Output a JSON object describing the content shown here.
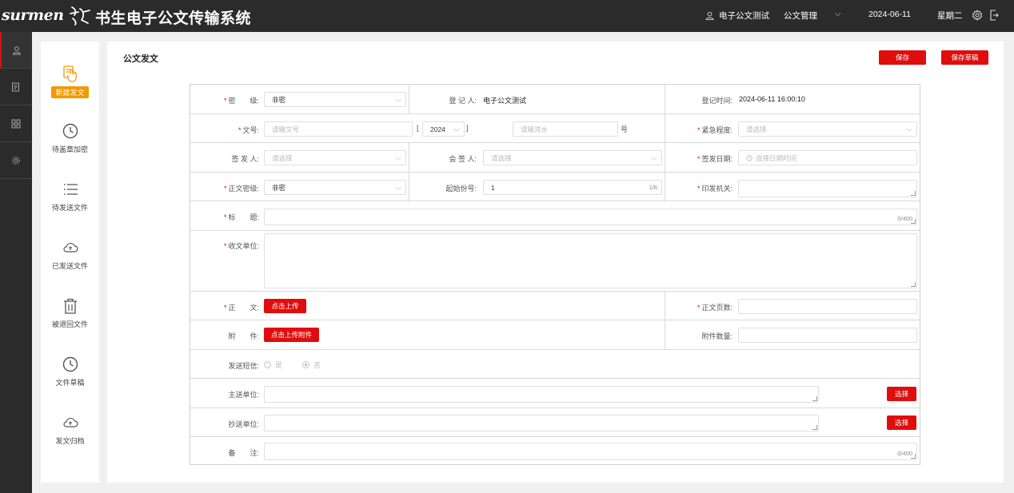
{
  "header": {
    "logo_text": "surmen",
    "app_title": "书生电子公文传输系统",
    "user_name": "电子公文测试",
    "menu_label": "公文管理",
    "date": "2024-06-11",
    "weekday": "星期二",
    "icons": {
      "user": "user-icon",
      "chevron": "chevron-down-icon",
      "settings": "gear-icon",
      "logout": "logout-icon"
    }
  },
  "rail": {
    "items": [
      {
        "icon": "user-icon",
        "active": true
      },
      {
        "icon": "document-edit-icon",
        "active": false
      },
      {
        "icon": "grid-icon",
        "active": false
      },
      {
        "icon": "gear-icon",
        "active": false
      }
    ]
  },
  "sidebar": {
    "items": [
      {
        "label": "新建发文",
        "icon": "hand-document-icon",
        "active": true
      },
      {
        "label": "待盖章加密",
        "icon": "clock-icon",
        "active": false
      },
      {
        "label": "待发送文件",
        "icon": "list-icon",
        "active": false
      },
      {
        "label": "已发送文件",
        "icon": "cloud-upload-icon",
        "active": false
      },
      {
        "label": "被退回文件",
        "icon": "trash-icon",
        "active": false
      },
      {
        "label": "文件草稿",
        "icon": "clock-icon",
        "active": false
      },
      {
        "label": "发文归档",
        "icon": "cloud-upload-icon",
        "active": false
      }
    ]
  },
  "main": {
    "title": "公文发文",
    "save_label": "保存",
    "save_draft_label": "保存草稿"
  },
  "form": {
    "secret_level": {
      "label": "密　　级:",
      "value": "非密",
      "required": true
    },
    "registrar": {
      "label": "登 记 人:",
      "value": "电子公文测试"
    },
    "register_time": {
      "label": "登记时间:",
      "value": "2024-06-11 16:00:10"
    },
    "doc_number": {
      "label": "文号:",
      "placeholder": "请输文号",
      "required": true,
      "bracket_open": "[",
      "bracket_close": "]",
      "year": "2024",
      "serial_placeholder": "请输流水",
      "suffix": "号"
    },
    "urgency": {
      "label": "紧急程度:",
      "placeholder": "请选择",
      "required": true
    },
    "issuer": {
      "label": "签 发 人:",
      "placeholder": "请选择"
    },
    "co_signer": {
      "label": "会 签 人:",
      "placeholder": "请选择"
    },
    "issue_date": {
      "label": "签发日期:",
      "placeholder": "选择日期时间",
      "required": true
    },
    "body_secret_level": {
      "label": "正文密级:",
      "value": "非密",
      "required": true
    },
    "start_copy_no": {
      "label": "起始份号:",
      "value": "1",
      "counter": "1/6"
    },
    "printing_org": {
      "label": "印发机关:",
      "required": true
    },
    "subject": {
      "label": "标　　题:",
      "counter": "0/400",
      "required": true
    },
    "recipient_units": {
      "label": "收文单位:",
      "required": true
    },
    "body": {
      "label": "正　　文:",
      "button": "点击上传",
      "required": true
    },
    "body_pages": {
      "label": "正文页数:",
      "required": true
    },
    "attachment": {
      "label": "附　　件:",
      "button": "点击上传附件"
    },
    "attachment_count": {
      "label": "附件数量:"
    },
    "send_sms": {
      "label": "发送短信:",
      "options": [
        "是",
        "否"
      ],
      "selected": "否"
    },
    "main_send_units": {
      "label": "主送单位:",
      "button": "选择"
    },
    "cc_units": {
      "label": "抄送单位:",
      "button": "选择"
    },
    "remarks": {
      "label": "备　　注:",
      "counter": "0/400"
    }
  },
  "colors": {
    "topbar": "#2b2b2b",
    "accent_red": "#e00d0d",
    "active_orange": "#f39800"
  }
}
